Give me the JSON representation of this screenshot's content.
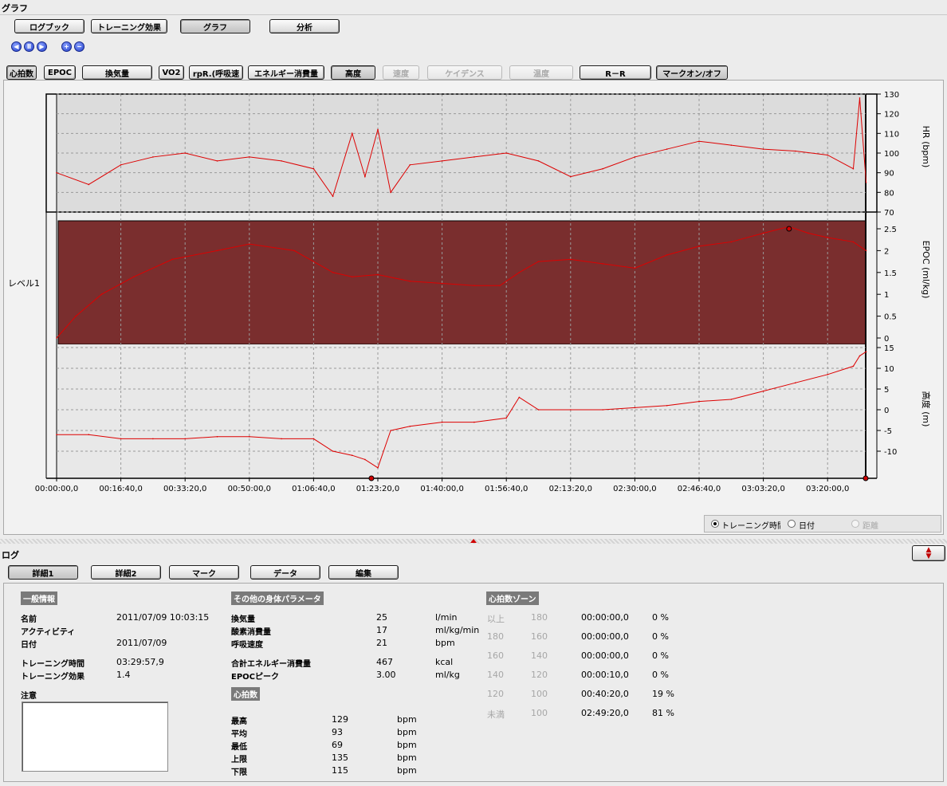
{
  "graph_section": {
    "title": "グラフ"
  },
  "top_tabs": [
    "ログブック",
    "トレーニング効果",
    "グラフ",
    "分析"
  ],
  "param_buttons": [
    {
      "label": "心拍数",
      "state": "active"
    },
    {
      "label": "EPOC",
      "state": "normal"
    },
    {
      "label": "換気量",
      "state": "normal"
    },
    {
      "label": "VO2",
      "state": "normal"
    },
    {
      "label": "rpR.(呼吸速",
      "state": "normal"
    },
    {
      "label": "エネルギー消費量",
      "state": "normal"
    },
    {
      "label": "高度",
      "state": "active"
    },
    {
      "label": "速度",
      "state": "disabled"
    },
    {
      "label": "ケイデンス",
      "state": "disabled"
    },
    {
      "label": "温度",
      "state": "disabled"
    },
    {
      "label": "R－R",
      "state": "normal"
    },
    {
      "label": "マークオン/オフ",
      "state": "active"
    }
  ],
  "level_label": "レベル1",
  "hr_axis": {
    "label": "HR (bpm)",
    "ticks": [
      "130",
      "120",
      "110",
      "100",
      "90",
      "80",
      "70"
    ]
  },
  "epoc_axis": {
    "label": "EPOC (ml/kg)",
    "ticks": [
      "2.5",
      "2",
      "1.5",
      "1",
      "0.5",
      "0"
    ]
  },
  "alt_axis": {
    "label": "高度 (m)",
    "ticks": [
      "15",
      "10",
      "5",
      "0",
      "-5",
      "-10"
    ]
  },
  "x_ticks": [
    "00:00:00,0",
    "00:16:40,0",
    "00:33:20,0",
    "00:50:00,0",
    "01:06:40,0",
    "01:23:20,0",
    "01:40:00,0",
    "01:56:40,0",
    "02:13:20,0",
    "02:30:00,0",
    "02:46:40,0",
    "03:03:20,0",
    "03:20:00,0"
  ],
  "x_modes": [
    {
      "label": "トレーニング時間",
      "selected": true,
      "disabled": false
    },
    {
      "label": "日付",
      "selected": false,
      "disabled": false
    },
    {
      "label": "距離",
      "selected": false,
      "disabled": true
    }
  ],
  "log_section": {
    "title": "ログ"
  },
  "log_tabs": [
    "詳細1",
    "詳細2",
    "マーク",
    "データ",
    "編集"
  ],
  "general": {
    "header": "一般情報",
    "rows": [
      {
        "label": "名前",
        "value": "2011/07/09 10:03:15"
      },
      {
        "label": "アクティビティ",
        "value": ""
      },
      {
        "label": "日付",
        "value": "2011/07/09"
      },
      {
        "label": "トレーニング時間",
        "value": "03:29:57,9"
      },
      {
        "label": "トレーニング効果",
        "value": "1.4"
      }
    ],
    "note_label": "注意",
    "note_value": ""
  },
  "other_params": {
    "header": "その他の身体パラメータ",
    "rows": [
      {
        "label": "換気量",
        "value": "25",
        "unit": "l/min"
      },
      {
        "label": "酸素消費量",
        "value": "17",
        "unit": "ml/kg/min"
      },
      {
        "label": "呼吸速度",
        "value": "21",
        "unit": "bpm"
      },
      {
        "label": "合計エネルギー消費量",
        "value": "467",
        "unit": "kcal"
      },
      {
        "label": "EPOCピーク",
        "value": "3.00",
        "unit": "ml/kg"
      }
    ]
  },
  "hr_stats": {
    "header": "心拍数",
    "rows": [
      {
        "label": "最高",
        "value": "129",
        "unit": "bpm"
      },
      {
        "label": "平均",
        "value": "93",
        "unit": "bpm"
      },
      {
        "label": "最低",
        "value": "69",
        "unit": "bpm"
      },
      {
        "label": "上限",
        "value": "135",
        "unit": "bpm"
      },
      {
        "label": "下限",
        "value": "115",
        "unit": "bpm"
      }
    ]
  },
  "hr_zones": {
    "header": "心拍数ゾーン",
    "rows": [
      {
        "from": "以上",
        "to": "180",
        "time": "00:00:00,0",
        "pct": "0 %"
      },
      {
        "from": "180",
        "to": "160",
        "time": "00:00:00,0",
        "pct": "0 %"
      },
      {
        "from": "160",
        "to": "140",
        "time": "00:00:00,0",
        "pct": "0 %"
      },
      {
        "from": "140",
        "to": "120",
        "time": "00:00:10,0",
        "pct": "0 %"
      },
      {
        "from": "120",
        "to": "100",
        "time": "00:40:20,0",
        "pct": "19 %"
      },
      {
        "from": "未満",
        "to": "100",
        "time": "02:49:20,0",
        "pct": "81 %"
      }
    ]
  },
  "chart_data": [
    {
      "type": "line",
      "ylabel": "HR (bpm)",
      "ylim": [
        70,
        130
      ],
      "x_unit": "seconds",
      "series": [
        {
          "name": "HR",
          "color": "#dd0000",
          "x": [
            0,
            500,
            1000,
            1500,
            2000,
            2500,
            3000,
            3500,
            4000,
            4300,
            4600,
            4800,
            5000,
            5200,
            5500,
            6000,
            6500,
            7000,
            7500,
            8000,
            8500,
            9000,
            9500,
            10000,
            10500,
            11000,
            11500,
            12000,
            12400,
            12500,
            12600
          ],
          "y": [
            90,
            84,
            94,
            98,
            100,
            96,
            98,
            96,
            92,
            78,
            110,
            88,
            112,
            80,
            94,
            96,
            98,
            100,
            96,
            88,
            92,
            98,
            102,
            106,
            104,
            102,
            101,
            99,
            92,
            128,
            85
          ]
        }
      ]
    },
    {
      "type": "line",
      "ylabel": "EPOC (ml/kg)",
      "ylim": [
        0,
        2.7
      ],
      "x_unit": "seconds",
      "series": [
        {
          "name": "EPOC",
          "color": "#dd0000",
          "x": [
            0,
            300,
            700,
            1200,
            1800,
            2500,
            3000,
            3700,
            4300,
            4600,
            5000,
            5500,
            6000,
            6500,
            6900,
            7200,
            7500,
            8000,
            8500,
            9000,
            9500,
            10000,
            10500,
            11000,
            11400,
            11700,
            12000,
            12400,
            12600
          ],
          "y": [
            0,
            0.5,
            1,
            1.4,
            1.8,
            2.0,
            2.15,
            2.0,
            1.5,
            1.4,
            1.45,
            1.3,
            1.25,
            1.2,
            1.2,
            1.5,
            1.75,
            1.8,
            1.7,
            1.6,
            1.9,
            2.1,
            2.2,
            2.4,
            2.55,
            2.4,
            2.3,
            2.2,
            2.0
          ]
        }
      ]
    },
    {
      "type": "line",
      "ylabel": "高度 (m)",
      "ylim": [
        -15,
        15
      ],
      "x_unit": "seconds",
      "series": [
        {
          "name": "高度",
          "color": "#dd0000",
          "x": [
            0,
            500,
            1000,
            1500,
            2000,
            2500,
            3000,
            3500,
            4000,
            4300,
            4600,
            4800,
            5000,
            5200,
            5500,
            6000,
            6500,
            7000,
            7200,
            7500,
            8000,
            8500,
            9000,
            9500,
            10000,
            10500,
            11000,
            11500,
            12000,
            12400,
            12500,
            12600
          ],
          "y": [
            -6,
            -6,
            -7,
            -7,
            -7,
            -6.5,
            -6.5,
            -7,
            -7,
            -10,
            -11,
            -12,
            -14,
            -5,
            -4,
            -3,
            -3,
            -2,
            3,
            0,
            0,
            0,
            0.5,
            1,
            2,
            2.5,
            4.5,
            6.5,
            8.5,
            10.5,
            13,
            14
          ]
        }
      ]
    }
  ]
}
